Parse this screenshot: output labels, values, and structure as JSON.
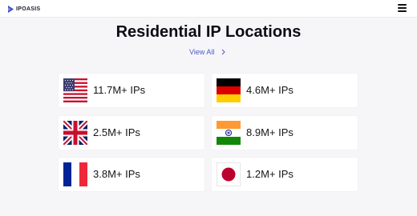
{
  "header": {
    "brand": "IPOASIS",
    "logo_icon": "ipoasis-logo-icon",
    "menu_icon": "hamburger-menu-icon"
  },
  "main": {
    "title": "Residential IP Locations",
    "view_all_label": "View All",
    "view_all_icon": "chevron-right-icon",
    "accent_color": "#4b59c9"
  },
  "locations": [
    {
      "flag_icon": "usa-flag-icon",
      "count": "11.7M+ IPs"
    },
    {
      "flag_icon": "germany-flag-icon",
      "count": "4.6M+ IPs"
    },
    {
      "flag_icon": "uk-flag-icon",
      "count": "2.5M+ IPs"
    },
    {
      "flag_icon": "india-flag-icon",
      "count": "8.9M+ IPs"
    },
    {
      "flag_icon": "france-flag-icon",
      "count": "3.8M+ IPs"
    },
    {
      "flag_icon": "japan-flag-icon",
      "count": "1.2M+ IPs"
    }
  ]
}
